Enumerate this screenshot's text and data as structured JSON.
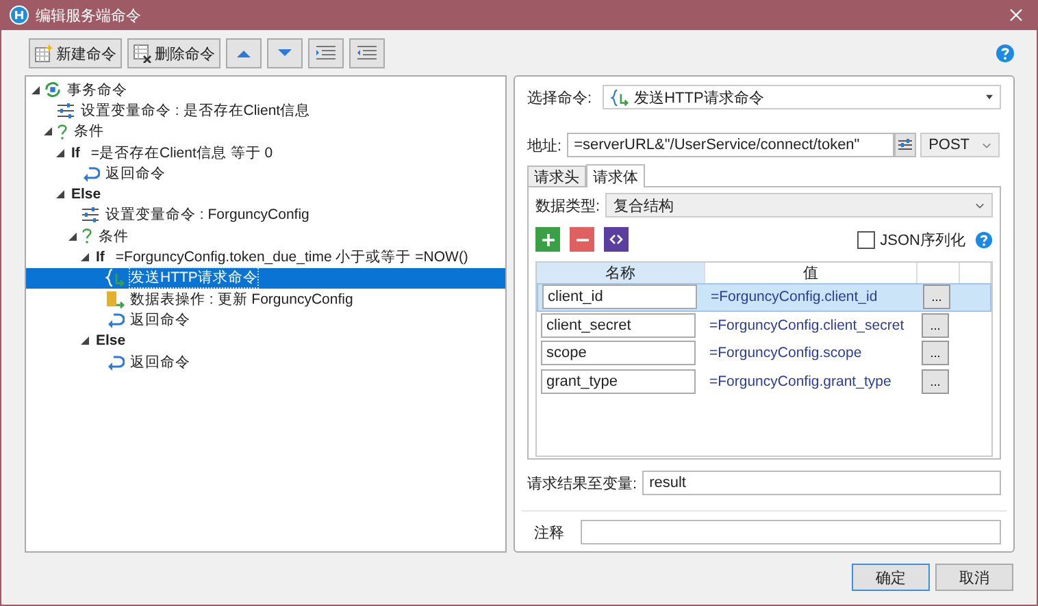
{
  "window": {
    "title": "编辑服务端命令"
  },
  "toolbar": {
    "buttons": [
      {
        "kind": "new",
        "label": "新建命令"
      },
      {
        "kind": "delete",
        "label": "删除命令"
      },
      {
        "kind": "up"
      },
      {
        "kind": "down"
      },
      {
        "kind": "indent"
      },
      {
        "kind": "outdent"
      }
    ]
  },
  "tree": {
    "items": [
      {
        "kind": "transaction",
        "label": "事务命令",
        "expanded": true,
        "selected": false,
        "children": [
          {
            "kind": "setvar",
            "label": "设置变量命令 : 是否存在Client信息",
            "selected": false
          },
          {
            "kind": "condition",
            "label": "条件",
            "expanded": true,
            "selected": false,
            "children": [
              {
                "kind": "if",
                "keyword": "If",
                "label": "=是否存在Client信息 等于 0",
                "expanded": true,
                "selected": false,
                "children": [
                  {
                    "kind": "return",
                    "label": "返回命令",
                    "selected": false
                  }
                ]
              },
              {
                "kind": "else",
                "keyword": "Else",
                "expanded": true,
                "selected": false,
                "children": [
                  {
                    "kind": "setvar",
                    "label": "设置变量命令 : ForguncyConfig",
                    "selected": false
                  },
                  {
                    "kind": "condition",
                    "label": "条件",
                    "expanded": true,
                    "selected": false,
                    "children": [
                      {
                        "kind": "if",
                        "keyword": "If",
                        "label": "=ForguncyConfig.token_due_time 小于或等于 =NOW()",
                        "expanded": true,
                        "selected": false,
                        "children": [
                          {
                            "kind": "http",
                            "label": "发送HTTP请求命令",
                            "selected": true
                          },
                          {
                            "kind": "table",
                            "label": "数据表操作 : 更新 ForguncyConfig",
                            "selected": false
                          },
                          {
                            "kind": "return",
                            "label": "返回命令",
                            "selected": false
                          }
                        ]
                      },
                      {
                        "kind": "else",
                        "keyword": "Else",
                        "expanded": true,
                        "selected": false,
                        "children": [
                          {
                            "kind": "return",
                            "label": "返回命令",
                            "selected": false
                          }
                        ]
                      }
                    ]
                  }
                ]
              }
            ]
          }
        ]
      }
    ]
  },
  "command": {
    "label": "选择命令:",
    "value": "发送HTTP请求命令"
  },
  "address": {
    "label": "地址:",
    "value": "=serverURL&\"/UserService/connect/token\"",
    "method": "POST"
  },
  "tabs": [
    {
      "label": "请求头",
      "selected": false
    },
    {
      "label": "请求体",
      "selected": true
    }
  ],
  "body": {
    "data_type_label": "数据类型:",
    "data_type": "复合结构",
    "json_serialize": {
      "label": "JSON序列化",
      "checked": false
    },
    "columns": [
      "名称",
      "值"
    ],
    "rows": [
      {
        "name": "client_id",
        "value": "=ForguncyConfig.client_id",
        "button": "...",
        "selected": true
      },
      {
        "name": "client_secret",
        "value": "=ForguncyConfig.client_secret",
        "button": "...",
        "selected": false
      },
      {
        "name": "scope",
        "value": "=ForguncyConfig.scope",
        "button": "...",
        "selected": false
      },
      {
        "name": "grant_type",
        "value": "=ForguncyConfig.grant_type",
        "button": "...",
        "selected": false
      }
    ]
  },
  "result": {
    "label": "请求结果至变量:",
    "value": "result"
  },
  "comment": {
    "label": "注释"
  },
  "buttons": [
    {
      "label": "确定",
      "kind": "default"
    },
    {
      "label": "取消",
      "kind": "normal"
    }
  ]
}
